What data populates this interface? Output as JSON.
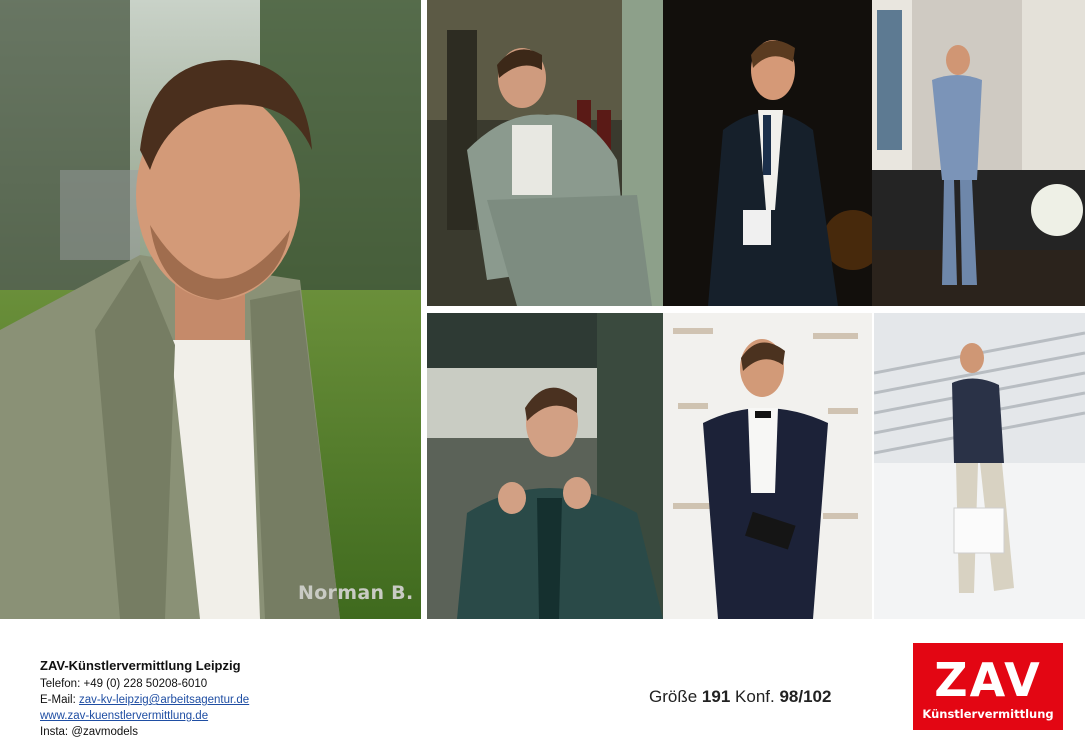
{
  "model": {
    "name": "Norman B."
  },
  "photos": [
    {
      "label": "main-portrait"
    },
    {
      "label": "seated-lounge"
    },
    {
      "label": "stage-dark-suit"
    },
    {
      "label": "stage-microphone"
    },
    {
      "label": "green-suit-terrace"
    },
    {
      "label": "tuxedo-red-carpet"
    },
    {
      "label": "blazer-stairs"
    }
  ],
  "contact": {
    "agency": "ZAV-Künstlervermittlung Leipzig",
    "phone": "Telefon: +49 (0) 228 50208-6010",
    "email_label": "E-Mail: ",
    "email": "zav-kv-leipzig@arbeitsagentur.de",
    "website": "www.zav-kuenstlervermittlung.de",
    "insta": "Insta: @zavmodels"
  },
  "measures": {
    "size_label": "Größe",
    "size_value": "191",
    "konf_label": "Konf.",
    "konf_value": "98/102"
  },
  "logo": {
    "big": "ZAV",
    "small": "Künstlervermittlung",
    "color": "#e30613"
  }
}
